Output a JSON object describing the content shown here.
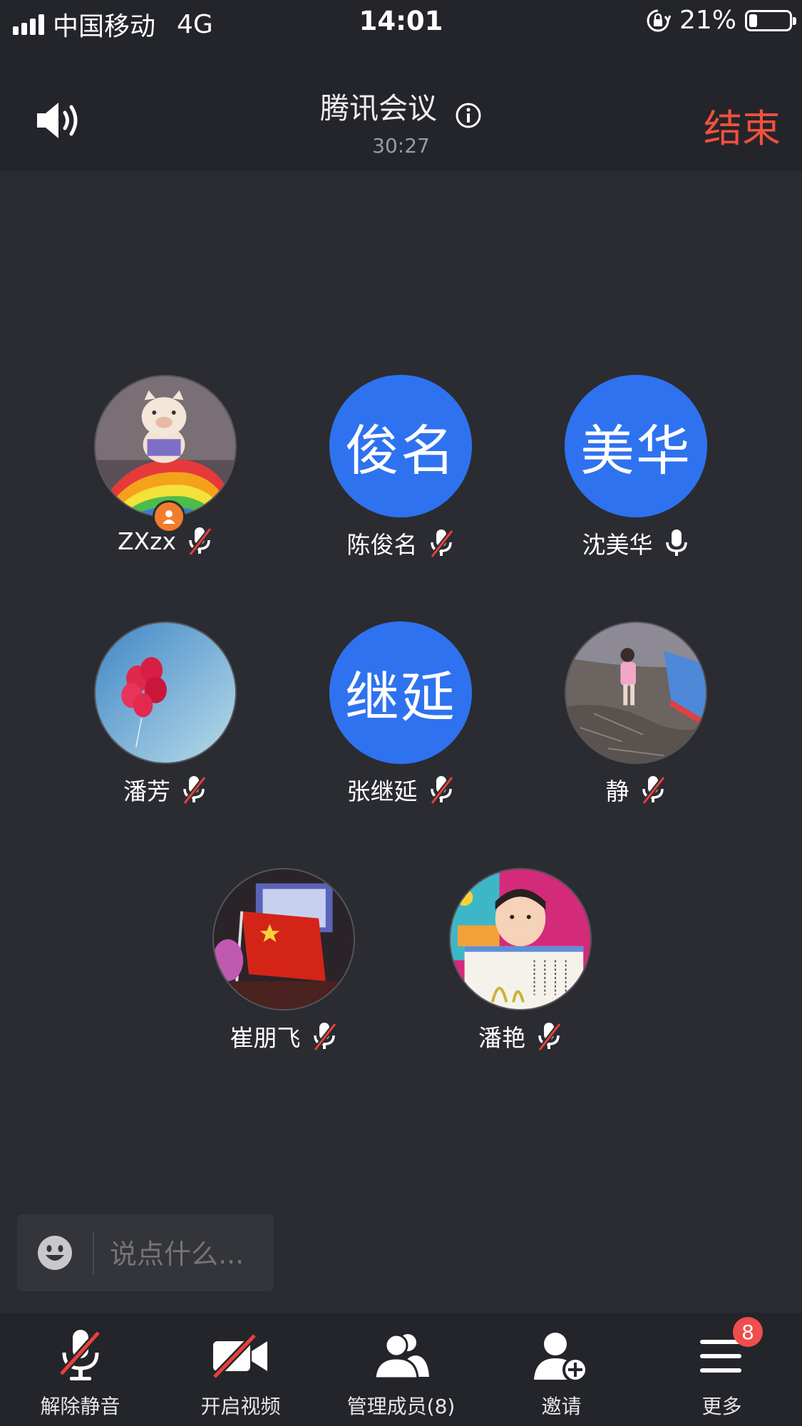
{
  "status_bar": {
    "carrier": "中国移动",
    "network": "4G",
    "time": "14:01",
    "battery_percent": "21%",
    "battery_level": 0.21,
    "icons": [
      "signal-icon",
      "rotation-lock-icon",
      "battery-icon"
    ]
  },
  "header": {
    "title": "腾讯会议",
    "duration": "30:27",
    "end_label": "结束",
    "end_color": "#f0503f",
    "icons": [
      "speaker-icon",
      "info-icon"
    ]
  },
  "participants": [
    {
      "name": "ZXzx",
      "avatar_type": "photo",
      "avatar_text": "",
      "mic": "muted",
      "host": true
    },
    {
      "name": "陈俊名",
      "avatar_type": "text",
      "avatar_text": "俊名",
      "mic": "muted",
      "host": false
    },
    {
      "name": "沈美华",
      "avatar_type": "text",
      "avatar_text": "美华",
      "mic": "on",
      "host": false
    },
    {
      "name": "潘芳",
      "avatar_type": "photo",
      "avatar_text": "",
      "mic": "muted",
      "host": false
    },
    {
      "name": "张继延",
      "avatar_type": "text",
      "avatar_text": "继延",
      "mic": "muted",
      "host": false
    },
    {
      "name": "静",
      "avatar_type": "photo",
      "avatar_text": "",
      "mic": "muted",
      "host": false
    },
    {
      "name": "崔朋飞",
      "avatar_type": "photo",
      "avatar_text": "",
      "mic": "muted",
      "host": false
    },
    {
      "name": "潘艳",
      "avatar_type": "photo",
      "avatar_text": "",
      "mic": "muted",
      "host": false
    }
  ],
  "chat": {
    "placeholder": "说点什么...",
    "icon": "emoji-icon"
  },
  "toolbar": {
    "unmute_label": "解除静音",
    "video_label": "开启视频",
    "members_label": "管理成员(8)",
    "invite_label": "邀请",
    "more_label": "更多",
    "more_badge": "8",
    "accent_color": "#2f72f0"
  }
}
